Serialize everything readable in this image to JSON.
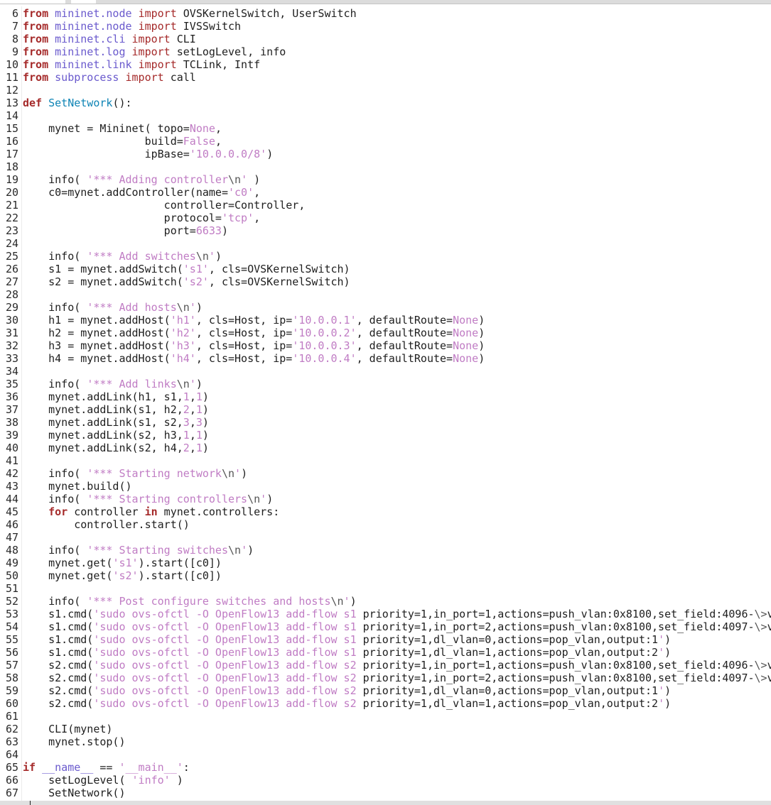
{
  "lines": [
    {
      "n": "6",
      "tokens": [
        [
          "kw",
          "from"
        ],
        [
          "t",
          " "
        ],
        [
          "mod",
          "mininet.node"
        ],
        [
          "t",
          " "
        ],
        [
          "imp",
          "import"
        ],
        [
          "t",
          " OVSKernelSwitch, UserSwitch"
        ]
      ]
    },
    {
      "n": "7",
      "tokens": [
        [
          "kw",
          "from"
        ],
        [
          "t",
          " "
        ],
        [
          "mod",
          "mininet.node"
        ],
        [
          "t",
          " "
        ],
        [
          "imp",
          "import"
        ],
        [
          "t",
          " IVSSwitch"
        ]
      ]
    },
    {
      "n": "8",
      "tokens": [
        [
          "kw",
          "from"
        ],
        [
          "t",
          " "
        ],
        [
          "mod",
          "mininet.cli"
        ],
        [
          "t",
          " "
        ],
        [
          "imp",
          "import"
        ],
        [
          "t",
          " CLI"
        ]
      ]
    },
    {
      "n": "9",
      "tokens": [
        [
          "kw",
          "from"
        ],
        [
          "t",
          " "
        ],
        [
          "mod",
          "mininet.log"
        ],
        [
          "t",
          " "
        ],
        [
          "imp",
          "import"
        ],
        [
          "t",
          " setLogLevel, info"
        ]
      ]
    },
    {
      "n": "10",
      "tokens": [
        [
          "kw",
          "from"
        ],
        [
          "t",
          " "
        ],
        [
          "mod",
          "mininet.link"
        ],
        [
          "t",
          " "
        ],
        [
          "imp",
          "import"
        ],
        [
          "t",
          " TCLink, Intf"
        ]
      ]
    },
    {
      "n": "11",
      "tokens": [
        [
          "kw",
          "from"
        ],
        [
          "t",
          " "
        ],
        [
          "mod",
          "subprocess"
        ],
        [
          "t",
          " "
        ],
        [
          "imp",
          "import"
        ],
        [
          "t",
          " call"
        ]
      ]
    },
    {
      "n": "12",
      "tokens": []
    },
    {
      "n": "13",
      "tokens": [
        [
          "kw",
          "def"
        ],
        [
          "t",
          " "
        ],
        [
          "fn",
          "SetNetwork"
        ],
        [
          "t",
          "():"
        ]
      ]
    },
    {
      "n": "14",
      "tokens": []
    },
    {
      "n": "15",
      "tokens": [
        [
          "t",
          "    mynet = Mininet( topo="
        ],
        [
          "const",
          "None"
        ],
        [
          "t",
          ","
        ]
      ]
    },
    {
      "n": "16",
      "tokens": [
        [
          "t",
          "                   build="
        ],
        [
          "const",
          "False"
        ],
        [
          "t",
          ","
        ]
      ]
    },
    {
      "n": "17",
      "tokens": [
        [
          "t",
          "                   ipBase="
        ],
        [
          "str",
          "'10.0.0.0/8'"
        ],
        [
          "t",
          ")"
        ]
      ]
    },
    {
      "n": "18",
      "tokens": []
    },
    {
      "n": "19",
      "tokens": [
        [
          "t",
          "    info( "
        ],
        [
          "str",
          "'*** Adding controller"
        ],
        [
          "esc",
          "\\n"
        ],
        [
          "str",
          "'"
        ],
        [
          "t",
          " )"
        ]
      ]
    },
    {
      "n": "20",
      "tokens": [
        [
          "t",
          "    c0=mynet.addController(name="
        ],
        [
          "str",
          "'c0'"
        ],
        [
          "t",
          ","
        ]
      ]
    },
    {
      "n": "21",
      "tokens": [
        [
          "t",
          "                      controller=Controller,"
        ]
      ]
    },
    {
      "n": "22",
      "tokens": [
        [
          "t",
          "                      protocol="
        ],
        [
          "str",
          "'tcp'"
        ],
        [
          "t",
          ","
        ]
      ]
    },
    {
      "n": "23",
      "tokens": [
        [
          "t",
          "                      port="
        ],
        [
          "num",
          "6633"
        ],
        [
          "t",
          ")"
        ]
      ]
    },
    {
      "n": "24",
      "tokens": []
    },
    {
      "n": "25",
      "tokens": [
        [
          "t",
          "    info( "
        ],
        [
          "str",
          "'*** Add switches"
        ],
        [
          "esc",
          "\\n"
        ],
        [
          "str",
          "'"
        ],
        [
          "t",
          ")"
        ]
      ]
    },
    {
      "n": "26",
      "tokens": [
        [
          "t",
          "    s1 = mynet.addSwitch("
        ],
        [
          "str",
          "'s1'"
        ],
        [
          "t",
          ", cls=OVSKernelSwitch)"
        ]
      ]
    },
    {
      "n": "27",
      "tokens": [
        [
          "t",
          "    s2 = mynet.addSwitch("
        ],
        [
          "str",
          "'s2'"
        ],
        [
          "t",
          ", cls=OVSKernelSwitch)"
        ]
      ]
    },
    {
      "n": "28",
      "tokens": []
    },
    {
      "n": "29",
      "tokens": [
        [
          "t",
          "    info( "
        ],
        [
          "str",
          "'*** Add hosts"
        ],
        [
          "esc",
          "\\n"
        ],
        [
          "str",
          "'"
        ],
        [
          "t",
          ")"
        ]
      ]
    },
    {
      "n": "30",
      "tokens": [
        [
          "t",
          "    h1 = mynet.addHost("
        ],
        [
          "str",
          "'h1'"
        ],
        [
          "t",
          ", cls=Host, ip="
        ],
        [
          "str",
          "'10.0.0.1'"
        ],
        [
          "t",
          ", defaultRoute="
        ],
        [
          "const",
          "None"
        ],
        [
          "t",
          ")"
        ]
      ]
    },
    {
      "n": "31",
      "tokens": [
        [
          "t",
          "    h2 = mynet.addHost("
        ],
        [
          "str",
          "'h2'"
        ],
        [
          "t",
          ", cls=Host, ip="
        ],
        [
          "str",
          "'10.0.0.2'"
        ],
        [
          "t",
          ", defaultRoute="
        ],
        [
          "const",
          "None"
        ],
        [
          "t",
          ")"
        ]
      ]
    },
    {
      "n": "32",
      "tokens": [
        [
          "t",
          "    h3 = mynet.addHost("
        ],
        [
          "str",
          "'h3'"
        ],
        [
          "t",
          ", cls=Host, ip="
        ],
        [
          "str",
          "'10.0.0.3'"
        ],
        [
          "t",
          ", defaultRoute="
        ],
        [
          "const",
          "None"
        ],
        [
          "t",
          ")"
        ]
      ]
    },
    {
      "n": "33",
      "tokens": [
        [
          "t",
          "    h4 = mynet.addHost("
        ],
        [
          "str",
          "'h4'"
        ],
        [
          "t",
          ", cls=Host, ip="
        ],
        [
          "str",
          "'10.0.0.4'"
        ],
        [
          "t",
          ", defaultRoute="
        ],
        [
          "const",
          "None"
        ],
        [
          "t",
          ")"
        ]
      ]
    },
    {
      "n": "34",
      "tokens": []
    },
    {
      "n": "35",
      "tokens": [
        [
          "t",
          "    info( "
        ],
        [
          "str",
          "'*** Add links"
        ],
        [
          "esc",
          "\\n"
        ],
        [
          "str",
          "'"
        ],
        [
          "t",
          ")"
        ]
      ]
    },
    {
      "n": "36",
      "tokens": [
        [
          "t",
          "    mynet.addLink(h1, s1,"
        ],
        [
          "num",
          "1"
        ],
        [
          "t",
          ","
        ],
        [
          "num",
          "1"
        ],
        [
          "t",
          ")"
        ]
      ]
    },
    {
      "n": "37",
      "tokens": [
        [
          "t",
          "    mynet.addLink(s1, h2,"
        ],
        [
          "num",
          "2"
        ],
        [
          "t",
          ","
        ],
        [
          "num",
          "1"
        ],
        [
          "t",
          ")"
        ]
      ]
    },
    {
      "n": "38",
      "tokens": [
        [
          "t",
          "    mynet.addLink(s1, s2,"
        ],
        [
          "num",
          "3"
        ],
        [
          "t",
          ","
        ],
        [
          "num",
          "3"
        ],
        [
          "t",
          ")"
        ]
      ]
    },
    {
      "n": "39",
      "tokens": [
        [
          "t",
          "    mynet.addLink(s2, h3,"
        ],
        [
          "num",
          "1"
        ],
        [
          "t",
          ","
        ],
        [
          "num",
          "1"
        ],
        [
          "t",
          ")"
        ]
      ]
    },
    {
      "n": "40",
      "tokens": [
        [
          "t",
          "    mynet.addLink(s2, h4,"
        ],
        [
          "num",
          "2"
        ],
        [
          "t",
          ","
        ],
        [
          "num",
          "1"
        ],
        [
          "t",
          ")"
        ]
      ]
    },
    {
      "n": "41",
      "tokens": []
    },
    {
      "n": "42",
      "tokens": [
        [
          "t",
          "    info( "
        ],
        [
          "str",
          "'*** Starting network"
        ],
        [
          "esc",
          "\\n"
        ],
        [
          "str",
          "'"
        ],
        [
          "t",
          ")"
        ]
      ]
    },
    {
      "n": "43",
      "tokens": [
        [
          "t",
          "    mynet.build()"
        ]
      ]
    },
    {
      "n": "44",
      "tokens": [
        [
          "t",
          "    info( "
        ],
        [
          "str",
          "'*** Starting controllers"
        ],
        [
          "esc",
          "\\n"
        ],
        [
          "str",
          "'"
        ],
        [
          "t",
          ")"
        ]
      ]
    },
    {
      "n": "45",
      "tokens": [
        [
          "t",
          "    "
        ],
        [
          "kw",
          "for"
        ],
        [
          "t",
          " controller "
        ],
        [
          "kw",
          "in"
        ],
        [
          "t",
          " mynet.controllers:"
        ]
      ]
    },
    {
      "n": "46",
      "tokens": [
        [
          "t",
          "        controller.start()"
        ]
      ]
    },
    {
      "n": "47",
      "tokens": []
    },
    {
      "n": "48",
      "tokens": [
        [
          "t",
          "    info( "
        ],
        [
          "str",
          "'*** Starting switches"
        ],
        [
          "esc",
          "\\n"
        ],
        [
          "str",
          "'"
        ],
        [
          "t",
          ")"
        ]
      ]
    },
    {
      "n": "49",
      "tokens": [
        [
          "t",
          "    mynet.get("
        ],
        [
          "str",
          "'s1'"
        ],
        [
          "t",
          ").start([c0])"
        ]
      ]
    },
    {
      "n": "50",
      "tokens": [
        [
          "t",
          "    mynet.get("
        ],
        [
          "str",
          "'s2'"
        ],
        [
          "t",
          ").start([c0])"
        ]
      ]
    },
    {
      "n": "51",
      "tokens": []
    },
    {
      "n": "52",
      "tokens": [
        [
          "t",
          "    info( "
        ],
        [
          "str",
          "'*** Post configure switches and hosts"
        ],
        [
          "esc",
          "\\n"
        ],
        [
          "str",
          "'"
        ],
        [
          "t",
          ")"
        ]
      ]
    },
    {
      "n": "53",
      "tokens": [
        [
          "t",
          "    s1.cmd("
        ],
        [
          "str",
          "'sudo ovs-ofctl -O OpenFlow13 add-flow s1 "
        ],
        [
          "t",
          "priority=1,in_port=1,actions=push_vlan:0x8100,set_field:4096-"
        ],
        [
          "esc",
          "\\>"
        ],
        [
          "t",
          "v"
        ]
      ]
    },
    {
      "n": "54",
      "tokens": [
        [
          "t",
          "    s1.cmd("
        ],
        [
          "str",
          "'sudo ovs-ofctl -O OpenFlow13 add-flow s1 "
        ],
        [
          "t",
          "priority=1,in_port=2,actions=push_vlan:0x8100,set_field:4097-"
        ],
        [
          "esc",
          "\\>"
        ],
        [
          "t",
          "v"
        ]
      ]
    },
    {
      "n": "55",
      "tokens": [
        [
          "t",
          "    s1.cmd("
        ],
        [
          "str",
          "'sudo ovs-ofctl -O OpenFlow13 add-flow s1 "
        ],
        [
          "t",
          "priority=1,dl_vlan=0,actions=pop_vlan,output:1"
        ],
        [
          "str",
          "'"
        ],
        [
          "t",
          ")"
        ]
      ]
    },
    {
      "n": "56",
      "tokens": [
        [
          "t",
          "    s1.cmd("
        ],
        [
          "str",
          "'sudo ovs-ofctl -O OpenFlow13 add-flow s1 "
        ],
        [
          "t",
          "priority=1,dl_vlan=1,actions=pop_vlan,output:2"
        ],
        [
          "str",
          "'"
        ],
        [
          "t",
          ")"
        ]
      ]
    },
    {
      "n": "57",
      "tokens": [
        [
          "t",
          "    s2.cmd("
        ],
        [
          "str",
          "'sudo ovs-ofctl -O OpenFlow13 add-flow s2 "
        ],
        [
          "t",
          "priority=1,in_port=1,actions=push_vlan:0x8100,set_field:4096-"
        ],
        [
          "esc",
          "\\>"
        ],
        [
          "t",
          "v"
        ]
      ]
    },
    {
      "n": "58",
      "tokens": [
        [
          "t",
          "    s2.cmd("
        ],
        [
          "str",
          "'sudo ovs-ofctl -O OpenFlow13 add-flow s2 "
        ],
        [
          "t",
          "priority=1,in_port=2,actions=push_vlan:0x8100,set_field:4097-"
        ],
        [
          "esc",
          "\\>"
        ],
        [
          "t",
          "v"
        ]
      ]
    },
    {
      "n": "59",
      "tokens": [
        [
          "t",
          "    s2.cmd("
        ],
        [
          "str",
          "'sudo ovs-ofctl -O OpenFlow13 add-flow s2 "
        ],
        [
          "t",
          "priority=1,dl_vlan=0,actions=pop_vlan,output:1"
        ],
        [
          "str",
          "'"
        ],
        [
          "t",
          ")"
        ]
      ]
    },
    {
      "n": "60",
      "tokens": [
        [
          "t",
          "    s2.cmd("
        ],
        [
          "str",
          "'sudo ovs-ofctl -O OpenFlow13 add-flow s2 "
        ],
        [
          "t",
          "priority=1,dl_vlan=1,actions=pop_vlan,output:2"
        ],
        [
          "str",
          "'"
        ],
        [
          "t",
          ")"
        ]
      ]
    },
    {
      "n": "61",
      "tokens": []
    },
    {
      "n": "62",
      "tokens": [
        [
          "t",
          "    CLI(mynet)"
        ]
      ]
    },
    {
      "n": "63",
      "tokens": [
        [
          "t",
          "    mynet.stop()"
        ]
      ]
    },
    {
      "n": "64",
      "tokens": []
    },
    {
      "n": "65",
      "tokens": [
        [
          "kw",
          "if"
        ],
        [
          "t",
          " "
        ],
        [
          "mod",
          "__name__"
        ],
        [
          "t",
          " == "
        ],
        [
          "str",
          "'__main__'"
        ],
        [
          "t",
          ":"
        ]
      ]
    },
    {
      "n": "66",
      "tokens": [
        [
          "t",
          "    setLogLevel( "
        ],
        [
          "str",
          "'info'"
        ],
        [
          "t",
          " )"
        ]
      ]
    },
    {
      "n": "67",
      "tokens": [
        [
          "t",
          "    SetNetwork()"
        ]
      ]
    }
  ],
  "colors": {
    "keyword": "#a52a2a",
    "module": "#6a5acd",
    "string": "#c07cc4",
    "escape": "#555555",
    "function": "#0e84b5",
    "text": "#1e1e1e",
    "background": "#ffffff"
  }
}
